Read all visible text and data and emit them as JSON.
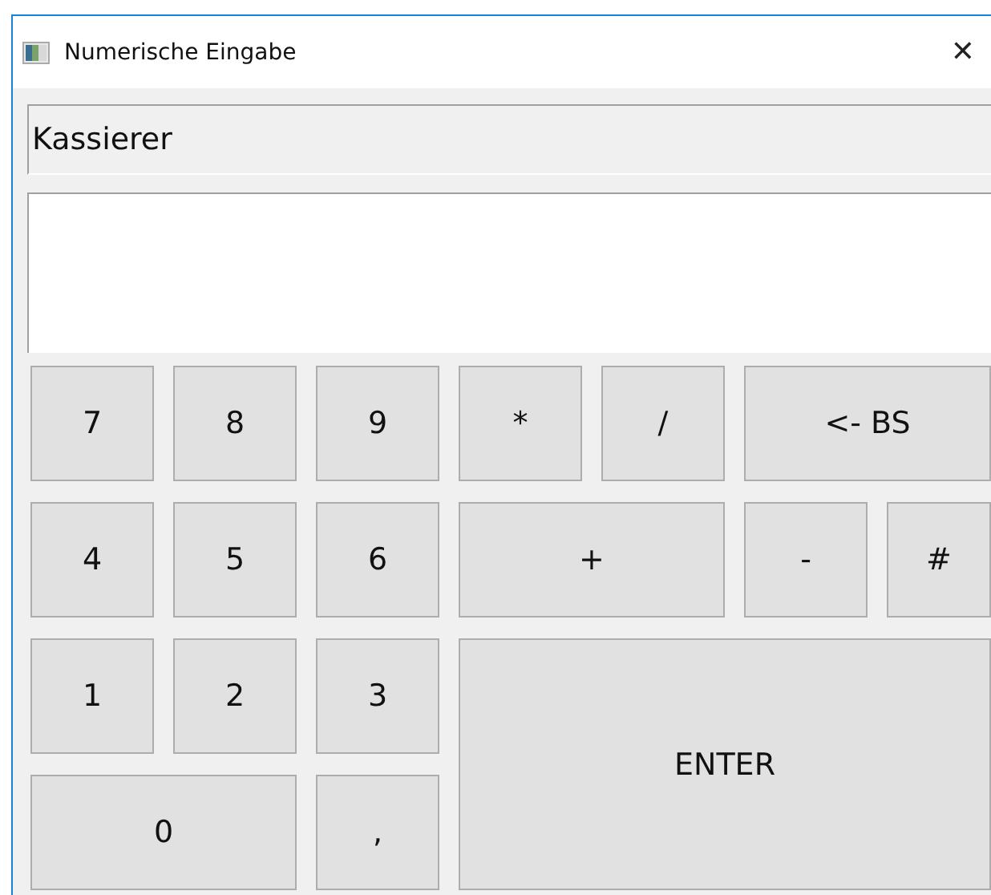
{
  "window": {
    "title": "Numerische Eingabe",
    "close": "✕"
  },
  "label": "Kassierer",
  "keys": [
    "7",
    "8",
    "9",
    "*",
    "/",
    "<- BS",
    "4",
    "5",
    "6",
    "+",
    "-",
    "#",
    "1",
    "2",
    "3",
    "ENTER",
    "0",
    ","
  ]
}
